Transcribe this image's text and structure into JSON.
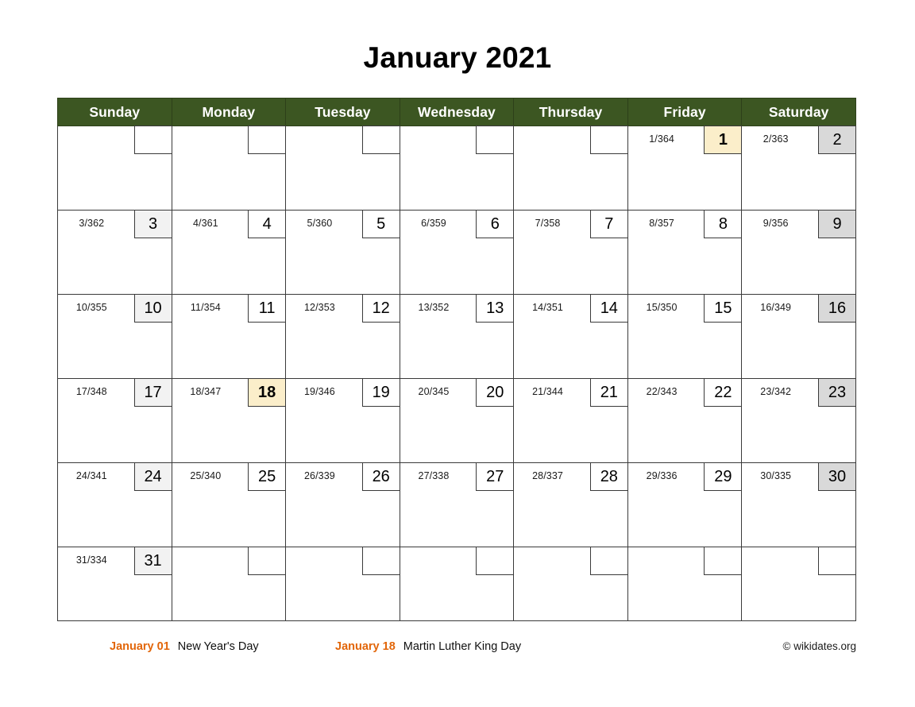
{
  "title": "January 2021",
  "colors": {
    "header_green": "#3c5622",
    "holiday_cream": "#fbeeca",
    "saturday_grey": "#d9d9d9",
    "sunday_grey": "#f2f2f2",
    "holiday_orange": "#e2660a",
    "grid_line": "#3a3a3a"
  },
  "weekdays": [
    "Sunday",
    "Monday",
    "Tuesday",
    "Wednesday",
    "Thursday",
    "Friday",
    "Saturday"
  ],
  "weeks": [
    [
      {
        "day": "",
        "doy": "",
        "kind": "empty"
      },
      {
        "day": "",
        "doy": "",
        "kind": "empty"
      },
      {
        "day": "",
        "doy": "",
        "kind": "empty"
      },
      {
        "day": "",
        "doy": "",
        "kind": "empty"
      },
      {
        "day": "",
        "doy": "",
        "kind": "empty"
      },
      {
        "day": "1",
        "doy": "1/364",
        "kind": "holiday"
      },
      {
        "day": "2",
        "doy": "2/363",
        "kind": "saturday"
      }
    ],
    [
      {
        "day": "3",
        "doy": "3/362",
        "kind": "sunday"
      },
      {
        "day": "4",
        "doy": "4/361",
        "kind": "weekday"
      },
      {
        "day": "5",
        "doy": "5/360",
        "kind": "weekday"
      },
      {
        "day": "6",
        "doy": "6/359",
        "kind": "weekday"
      },
      {
        "day": "7",
        "doy": "7/358",
        "kind": "weekday"
      },
      {
        "day": "8",
        "doy": "8/357",
        "kind": "weekday"
      },
      {
        "day": "9",
        "doy": "9/356",
        "kind": "saturday"
      }
    ],
    [
      {
        "day": "10",
        "doy": "10/355",
        "kind": "sunday"
      },
      {
        "day": "11",
        "doy": "11/354",
        "kind": "weekday"
      },
      {
        "day": "12",
        "doy": "12/353",
        "kind": "weekday"
      },
      {
        "day": "13",
        "doy": "13/352",
        "kind": "weekday"
      },
      {
        "day": "14",
        "doy": "14/351",
        "kind": "weekday"
      },
      {
        "day": "15",
        "doy": "15/350",
        "kind": "weekday"
      },
      {
        "day": "16",
        "doy": "16/349",
        "kind": "saturday"
      }
    ],
    [
      {
        "day": "17",
        "doy": "17/348",
        "kind": "sunday"
      },
      {
        "day": "18",
        "doy": "18/347",
        "kind": "holiday"
      },
      {
        "day": "19",
        "doy": "19/346",
        "kind": "weekday"
      },
      {
        "day": "20",
        "doy": "20/345",
        "kind": "weekday"
      },
      {
        "day": "21",
        "doy": "21/344",
        "kind": "weekday"
      },
      {
        "day": "22",
        "doy": "22/343",
        "kind": "weekday"
      },
      {
        "day": "23",
        "doy": "23/342",
        "kind": "saturday"
      }
    ],
    [
      {
        "day": "24",
        "doy": "24/341",
        "kind": "sunday"
      },
      {
        "day": "25",
        "doy": "25/340",
        "kind": "weekday"
      },
      {
        "day": "26",
        "doy": "26/339",
        "kind": "weekday"
      },
      {
        "day": "27",
        "doy": "27/338",
        "kind": "weekday"
      },
      {
        "day": "28",
        "doy": "28/337",
        "kind": "weekday"
      },
      {
        "day": "29",
        "doy": "29/336",
        "kind": "weekday"
      },
      {
        "day": "30",
        "doy": "30/335",
        "kind": "saturday"
      }
    ],
    [
      {
        "day": "31",
        "doy": "31/334",
        "kind": "sunday"
      },
      {
        "day": "",
        "doy": "",
        "kind": "empty"
      },
      {
        "day": "",
        "doy": "",
        "kind": "empty"
      },
      {
        "day": "",
        "doy": "",
        "kind": "empty"
      },
      {
        "day": "",
        "doy": "",
        "kind": "empty"
      },
      {
        "day": "",
        "doy": "",
        "kind": "empty"
      },
      {
        "day": "",
        "doy": "",
        "kind": "empty"
      }
    ]
  ],
  "footer": {
    "holidays": [
      {
        "date": "January 01",
        "name": "New Year's Day"
      },
      {
        "date": "January 18",
        "name": "Martin Luther King Day"
      }
    ],
    "copyright": "© wikidates.org"
  }
}
